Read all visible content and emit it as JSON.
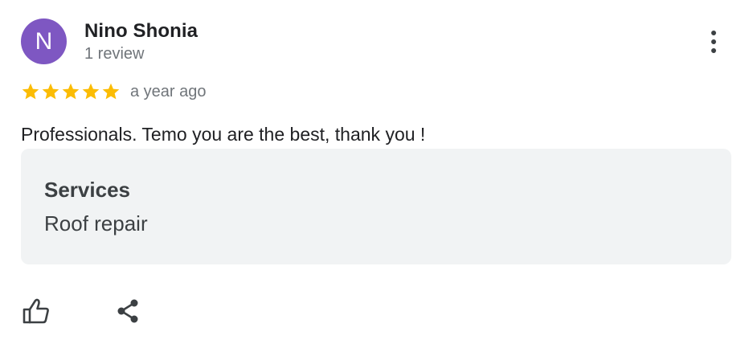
{
  "review": {
    "author": {
      "initial": "N",
      "name": "Nino Shonia",
      "review_count": "1 review",
      "avatar_color": "#7e57c2"
    },
    "rating": {
      "stars": 5,
      "max_stars": 5,
      "star_color": "#fbbc04",
      "timestamp": "a year ago"
    },
    "text": "Professionals. Temo you are the best, thank you !",
    "services": {
      "title": "Services",
      "value": "Roof repair"
    },
    "actions": {
      "like_icon": "thumbs-up-icon",
      "share_icon": "share-icon",
      "more_icon": "more-vert-icon"
    }
  }
}
